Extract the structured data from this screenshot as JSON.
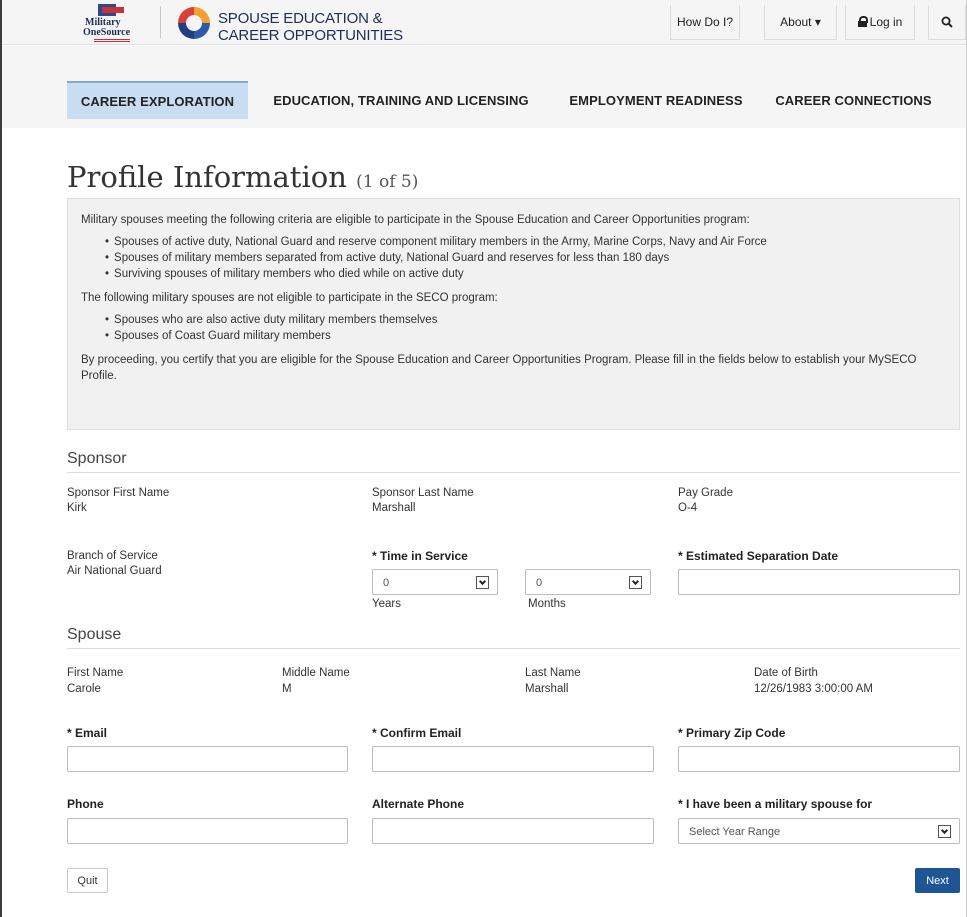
{
  "header": {
    "mos_logo_line1": "Military",
    "mos_logo_line2": "OneSource",
    "seco_line1": "SPOUSE EDUCATION &",
    "seco_line2": "CAREER OPPORTUNITIES",
    "how_do_i": "How Do I?",
    "about": "About ▾",
    "login": "Log in"
  },
  "nav": {
    "items": [
      {
        "label": "CAREER EXPLORATION"
      },
      {
        "label": "EDUCATION, TRAINING AND LICENSING"
      },
      {
        "label": "EMPLOYMENT READINESS"
      },
      {
        "label": "CAREER CONNECTIONS"
      }
    ]
  },
  "page": {
    "title": "Profile Information",
    "step": "(1 of 5)"
  },
  "eligibility": {
    "intro": "Military spouses meeting the following criteria are eligible to participate in the Spouse Education and Career Opportunities program:",
    "eligible": [
      "Spouses of active duty, National Guard and reserve component military members in the Army, Marine Corps, Navy and Air Force",
      "Spouses of military members separated from active duty, National Guard and reserves for less than 180 days",
      "Surviving spouses of military members who died while on active duty"
    ],
    "not_intro": "The following military spouses are not eligible to participate in the SECO program:",
    "not_eligible": [
      "Spouses who are also active duty military members themselves",
      "Spouses of Coast Guard military members"
    ],
    "certify": "By proceeding, you certify that you are eligible for the Spouse Education and Career Opportunities Program. Please fill in the fields below to establish your MySECO Profile."
  },
  "sponsor": {
    "section_title": "Sponsor",
    "first_name_label": "Sponsor First Name",
    "first_name": "Kirk",
    "last_name_label": "Sponsor Last Name",
    "last_name": "Marshall",
    "pay_grade_label": "Pay Grade",
    "pay_grade": "O-4",
    "branch_label": "Branch of Service",
    "branch": "Air National Guard",
    "time_in_service_label": "* Time in Service",
    "years_value": "0",
    "months_value": "0",
    "years_label": "Years",
    "months_label": "Months",
    "separation_label": "* Estimated Separation Date"
  },
  "spouse": {
    "section_title": "Spouse",
    "first_name_label": "First Name",
    "first_name": "Carole",
    "middle_name_label": "Middle Name",
    "middle_name": "M",
    "last_name_label": "Last Name",
    "last_name": "Marshall",
    "dob_label": "Date of Birth",
    "dob": "12/26/1983 3:00:00 AM",
    "email_label": "* Email",
    "confirm_email_label": "* Confirm Email",
    "zip_label": "* Primary Zip Code",
    "phone_label": "Phone",
    "alt_phone_label": "Alternate Phone",
    "spouse_for_label": "* I have been a military spouse for",
    "spouse_for_value": "Select Year Range"
  },
  "buttons": {
    "quit": "Quit",
    "next": "Next"
  }
}
